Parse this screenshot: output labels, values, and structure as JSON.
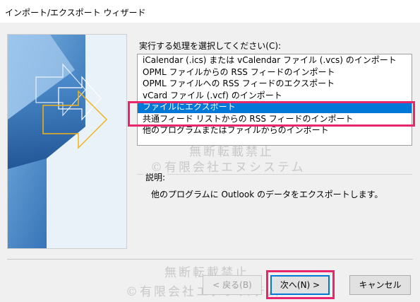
{
  "window": {
    "title": "インポート/エクスポート ウィザード"
  },
  "prompt": "実行する処理を選択してください(C):",
  "actions": [
    {
      "label": "iCalendar (.ics) または vCalendar ファイル (.vcs) のインポート",
      "selected": false
    },
    {
      "label": "OPML ファイルからの RSS フィードのインポート",
      "selected": false
    },
    {
      "label": "OPML ファイルへの RSS フィードのエクスポート",
      "selected": false
    },
    {
      "label": "vCard ファイル (.vcf) のインポート",
      "selected": false
    },
    {
      "label": "ファイルにエクスポート",
      "selected": true
    },
    {
      "label": "共通フィード リストからの RSS フィードのインポート",
      "selected": false
    },
    {
      "label": "他のプログラムまたはファイルからのインポート",
      "selected": false
    }
  ],
  "description": {
    "label": "説明:",
    "text": "他のプログラムに Outlook のデータをエクスポートします。"
  },
  "buttons": {
    "back": "< 戻る(B)",
    "next": "次へ(N) >",
    "cancel": "キャンセル"
  },
  "watermarks": {
    "line1": "無断転載禁止",
    "line2": "©有限会社エヌシステム"
  },
  "colors": {
    "selection": "#0078d7",
    "highlight_outline": "#e8266e",
    "side_art_blue": "#2f6fb5",
    "arrow_yellow": "#f2b21b"
  }
}
